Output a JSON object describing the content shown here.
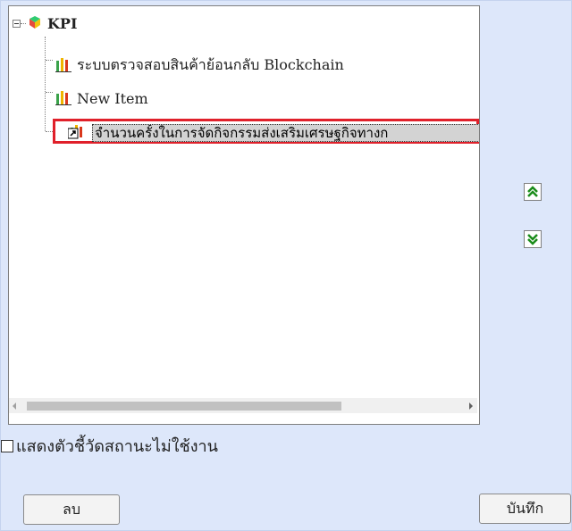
{
  "tree": {
    "root": {
      "label": "KPI",
      "icon": "kpi-root-icon"
    },
    "items": [
      {
        "label": "ระบบตรวจสอบสินค้าย้อนกลับ Blockchain",
        "icon": "bar-chart-icon"
      },
      {
        "label": "New Item",
        "icon": "bar-chart-icon"
      },
      {
        "label": "จำนวนครั้งในการจัดกิจกรรมส่งเสริมเศรษฐกิจทางก",
        "icon": "linked-chart-icon",
        "selected": true
      }
    ]
  },
  "controls": {
    "move_up_icon": "double-chevron-up-icon",
    "move_down_icon": "double-chevron-down-icon"
  },
  "options": {
    "show_inactive_label": "แสดงตัวชี้วัดสถานะไม่ใช้งาน",
    "show_inactive_checked": false
  },
  "buttons": {
    "delete_label": "ลบ",
    "save_label": "บันทึก"
  },
  "colors": {
    "background": "#dde7fa",
    "highlight_border": "#e0202a",
    "selection_fill": "#d3d3d3",
    "arrow_green": "#1a8c1a"
  }
}
